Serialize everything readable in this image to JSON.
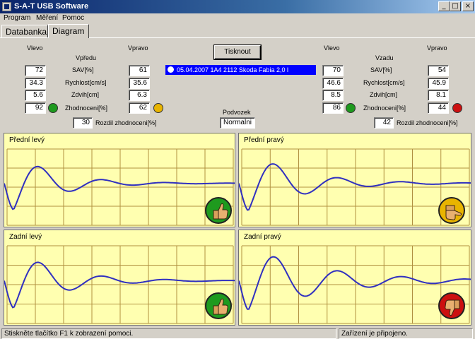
{
  "window": {
    "title": "S-A-T USB Software"
  },
  "menu": [
    "Program",
    "Měření",
    "Pomoc"
  ],
  "tabs": [
    "Databanka",
    "Diagram"
  ],
  "front": {
    "heading": "Vpředu",
    "left_label": "Vlevo",
    "right_label": "Vpravo",
    "rows": [
      {
        "label": "SAV[%]",
        "left": "72",
        "right": "61"
      },
      {
        "label": "Rychlost[cm/s]",
        "left": "34.3",
        "right": "35.6"
      },
      {
        "label": "Zdvih[cm]",
        "left": "5.6",
        "right": "6.3"
      },
      {
        "label": "Zhodnoceni[%]",
        "left": "92",
        "right": "62"
      }
    ],
    "diff_value": "30",
    "diff_label": "Rozdil zhodnoceni[%]",
    "left_rating": "good",
    "right_rating": "fair"
  },
  "rear": {
    "heading": "Vzadu",
    "left_label": "Vlevo",
    "right_label": "Vpravo",
    "rows": [
      {
        "label": "SAV[%]",
        "left": "70",
        "right": "54"
      },
      {
        "label": "Rychlost[cm/s]",
        "left": "46.6",
        "right": "45.9"
      },
      {
        "label": "Zdvih[cm]",
        "left": "8.5",
        "right": "8.1"
      },
      {
        "label": "Zhodnoceni[%]",
        "left": "86",
        "right": "44"
      }
    ],
    "diff_value": "42",
    "diff_label": "Rozdil zhodnoceni[%]",
    "left_rating": "good",
    "right_rating": "poor"
  },
  "print_button": "Tisknout",
  "record": "05.04.2007 1A4 2112 Skoda Fabia 2,0 l",
  "chassis": {
    "label": "Podvozek",
    "value": "Normalni"
  },
  "colors": {
    "good": "#1e9a1e",
    "fair": "#e8b400",
    "poor": "#cc1010",
    "curve": "#3030c0",
    "grid": "#b09040",
    "selection": "#0000ff"
  },
  "charts": [
    {
      "title": "Přední levý",
      "rating": "good",
      "amp": 1.0,
      "decay": 0.55,
      "offset": 0.0
    },
    {
      "title": "Přední pravý",
      "rating": "fair",
      "amp": 1.0,
      "decay": 0.45,
      "offset": 0.0
    },
    {
      "title": "Zadní levý",
      "rating": "good",
      "amp": 1.0,
      "decay": 0.5,
      "offset": 0.0
    },
    {
      "title": "Zadní pravý",
      "rating": "poor",
      "amp": 1.0,
      "decay": 0.32,
      "offset": 0.0
    }
  ],
  "status": {
    "left": "Stiskněte tlačítko F1 k zobrazení pomoci.",
    "right": "Zařízení je připojeno."
  }
}
